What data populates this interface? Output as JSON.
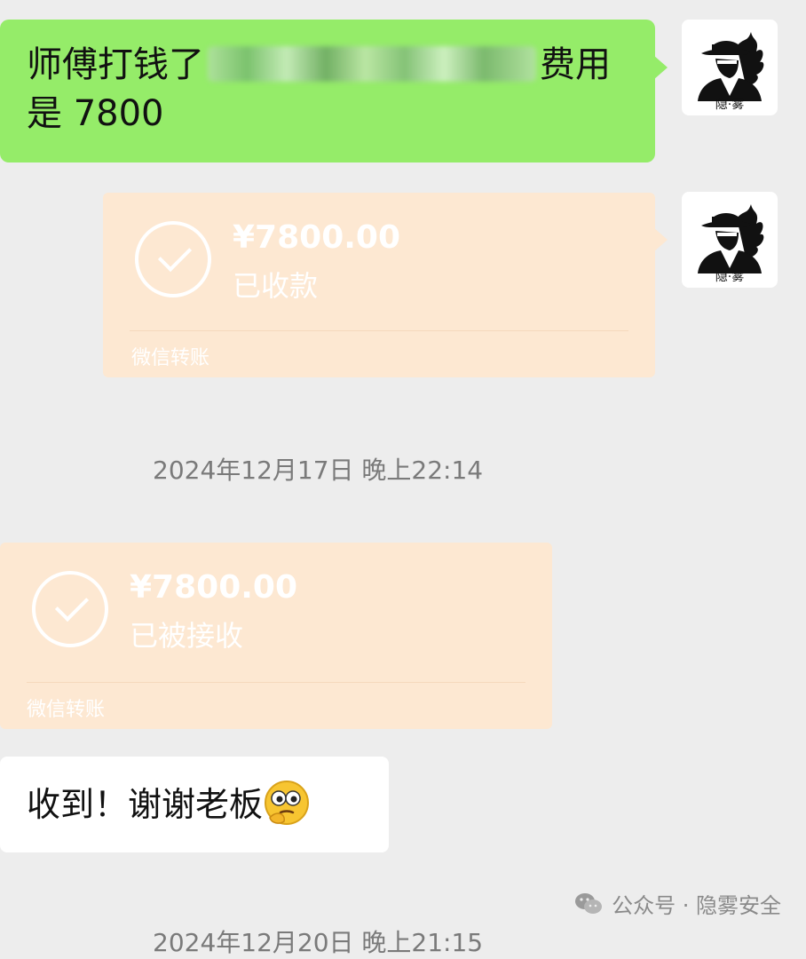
{
  "messages": {
    "outgoing_text": {
      "part1": "师傅打钱了",
      "part2": "费用",
      "line2": "是 7800"
    },
    "transfer_received": {
      "amount": "¥7800.00",
      "status": "已收款",
      "footer": "微信转账"
    },
    "timestamp_1": "2024年12月17日 晚上22:14",
    "transfer_accepted": {
      "amount": "¥7800.00",
      "status": "已被接收",
      "footer": "微信转账"
    },
    "incoming_text": "收到！谢谢老板",
    "timestamp_2_partial": "2024年12月20日 晚上21:15"
  },
  "avatar": {
    "label": "隐·雾",
    "icon": "hat-man-logo-icon"
  },
  "watermark": {
    "text": "公众号 · 隐雾安全",
    "icon": "wechat-official-icon"
  },
  "colors": {
    "background": "#ededed",
    "green_bubble": "#95ec69",
    "transfer_card": "#fde8d2",
    "white_bubble": "#ffffff",
    "timestamp_text": "#7a7a7a"
  }
}
